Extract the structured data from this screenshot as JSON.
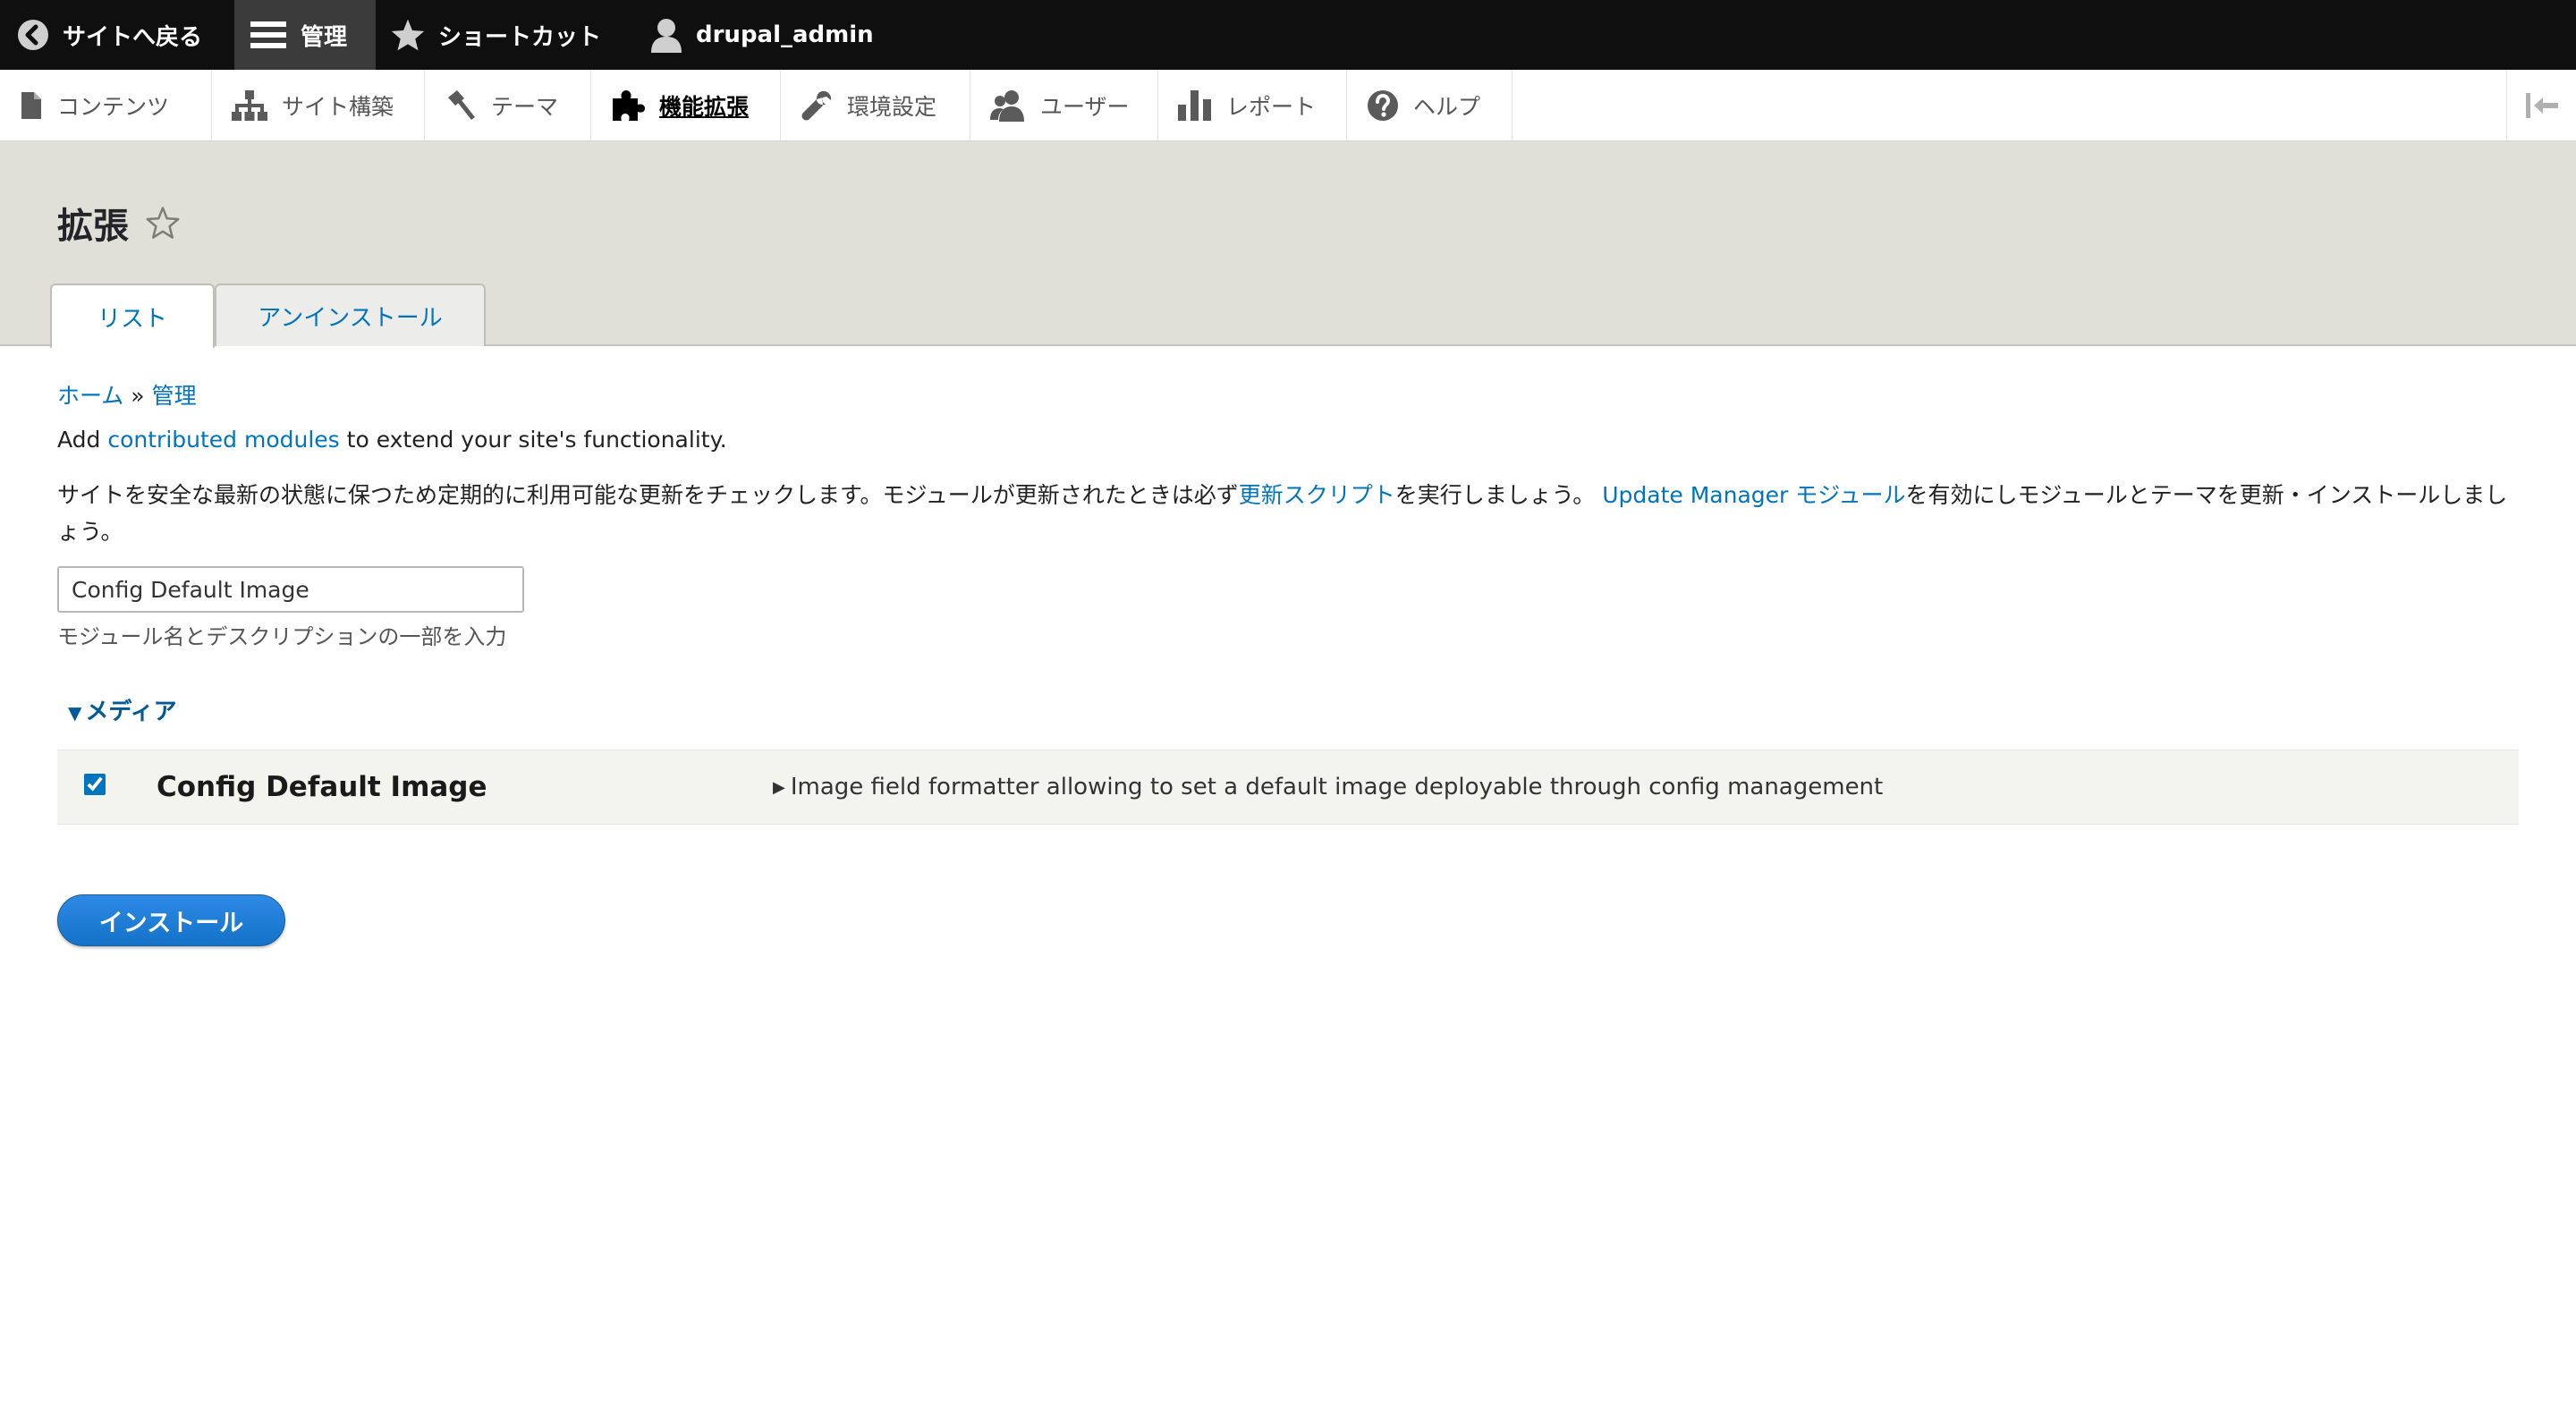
{
  "toolbar": {
    "back_label": "サイトへ戻る",
    "manage_label": "管理",
    "shortcuts_label": "ショートカット",
    "user_label": "drupal_admin"
  },
  "tray": {
    "items": [
      {
        "label": "コンテンツ",
        "icon": "file-icon"
      },
      {
        "label": "サイト構築",
        "icon": "sitemap-icon"
      },
      {
        "label": "テーマ",
        "icon": "paintbrush-icon"
      },
      {
        "label": "機能拡張",
        "icon": "puzzle-icon",
        "active": true
      },
      {
        "label": "環境設定",
        "icon": "wrench-icon"
      },
      {
        "label": "ユーザー",
        "icon": "people-icon"
      },
      {
        "label": "レポート",
        "icon": "bar-chart-icon"
      },
      {
        "label": "ヘルプ",
        "icon": "help-icon"
      }
    ]
  },
  "page": {
    "title": "拡張",
    "tabs": [
      {
        "label": "リスト",
        "active": true
      },
      {
        "label": "アンインストール",
        "active": false
      }
    ]
  },
  "breadcrumb": {
    "home": "ホーム",
    "separator": "»",
    "admin": "管理"
  },
  "intro": {
    "prefix": "Add ",
    "link": "contributed modules",
    "suffix": " to extend your site's functionality."
  },
  "notice": {
    "part1": "サイトを安全な最新の状態に保つため定期的に利用可能な更新をチェックします。モジュールが更新されたときは必ず",
    "link1": "更新スクリプト",
    "part2": "を実行しましょう。 ",
    "link2": "Update Manager モジュール",
    "part3": "を有効にしモジュールとテーマを更新・インストールしましょう。"
  },
  "filter": {
    "value": "Config Default Image",
    "help": "モジュール名とデスクリプションの一部を入力"
  },
  "group": {
    "label": "メディア",
    "marker": "▼"
  },
  "module": {
    "name": "Config Default Image",
    "description": "Image field formatter allowing to set a default image deployable through config management",
    "checked": true
  },
  "actions": {
    "install_label": "インストール"
  },
  "colors": {
    "link": "#0074bd",
    "toolbar_bg": "#0f0f0f",
    "header_bg": "#e0e0d8",
    "button": "#1472c8"
  }
}
